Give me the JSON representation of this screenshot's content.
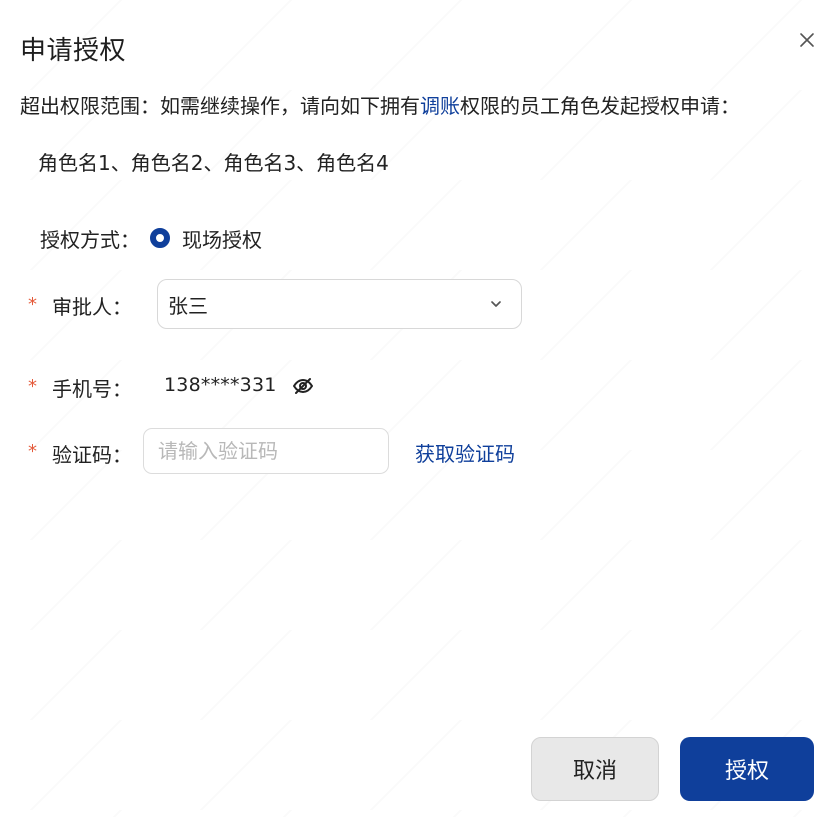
{
  "dialog": {
    "title": "申请授权",
    "description_prefix": "超出权限范围：如需继续操作，请向如下拥有",
    "permission_link": "调账",
    "description_suffix": "权限的员工角色发起授权申请：",
    "roles": "角色名1、角色名2、角色名3、角色名4"
  },
  "form": {
    "auth_method_label": "授权方式：",
    "auth_method_option": "现场授权",
    "approver_label": "审批人：",
    "approver_value": "张三",
    "phone_label": "手机号：",
    "phone_value": "138****331",
    "code_label": "验证码：",
    "code_placeholder": "请输入验证码",
    "get_code_label": "获取验证码",
    "required_mark": "*"
  },
  "actions": {
    "cancel_label": "取消",
    "authorize_label": "授权"
  },
  "colors": {
    "primary": "#0f3f9b",
    "required": "#e45a3a"
  },
  "icons": {
    "close": "close-icon",
    "dropdown": "chevron-down-icon",
    "eye": "eye-off-icon"
  }
}
